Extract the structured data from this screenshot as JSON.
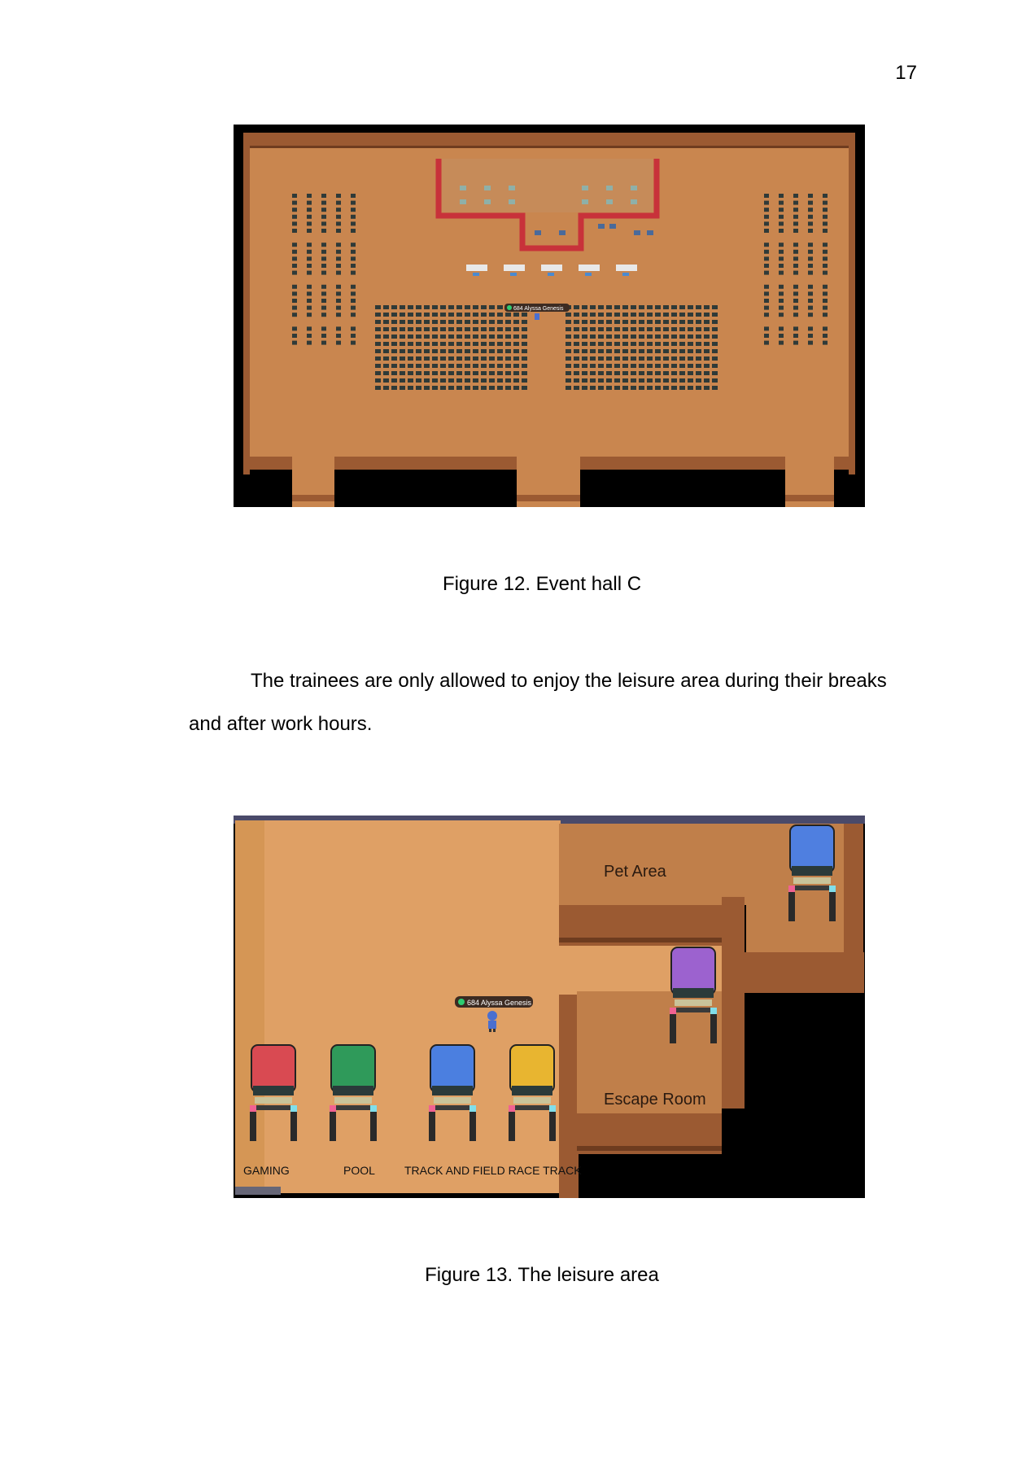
{
  "page_number": "17",
  "figure12": {
    "caption": "Figure 12. Event hall C",
    "avatar_label": "684 Alyssa Genesis"
  },
  "paragraph": "The trainees are only allowed to enjoy the leisure area during their breaks and after work hours.",
  "figure13": {
    "caption": "Figure 13. The leisure area",
    "avatar_label": "684 Alyssa Genesis",
    "area_labels": {
      "pet_area": "Pet Area",
      "escape_room": "Escape Room",
      "gaming": "GAMING",
      "pool": "POOL",
      "track": "TRACK AND FIELD RACE TRACK"
    },
    "portal_colors": {
      "gaming": "#d94a52",
      "pool": "#2f9a5a",
      "track": "#4b7fe0",
      "race": "#e8b530",
      "escape_room": "#9c62cf",
      "pet_area": "#4f7fe0"
    }
  }
}
